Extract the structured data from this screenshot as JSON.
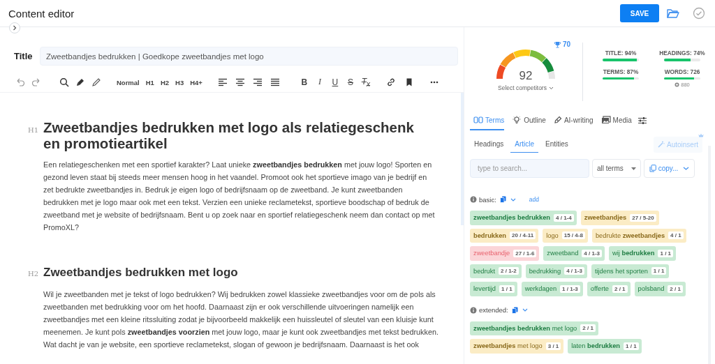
{
  "header": {
    "title": "Content editor",
    "save": "SAVE"
  },
  "title_field": {
    "label": "Title",
    "value": "Zweetbandjes bedrukken | Goedkope zweetbandjes met logo"
  },
  "toolbar": {
    "styles": [
      {
        "label": "Normal",
        "selected": false
      },
      {
        "label": "H1",
        "selected": false
      },
      {
        "label": "H2",
        "selected": false
      },
      {
        "label": "H3",
        "selected": false
      },
      {
        "label": "H4+",
        "selected": false
      }
    ],
    "formats": [
      "B",
      "I",
      "U",
      "S",
      "T$_{x}$"
    ]
  },
  "document": [
    {
      "kind": "heading",
      "tag": "H1",
      "text": "Zweetbandjes bedrukken met logo als relatiegeschenk en promotieartikel"
    },
    {
      "kind": "paragraph",
      "text": "Een relatiegeschenken met een sportief karakter? Laat unieke **zweetbandjes bedrukken** met jouw logo! Sporten en gezond leven staat bij steeds meer mensen hoog in het vaandel. Promoot ook het sportieve imago van je bedrijf en zet bedrukte zweetbandjes in. Bedruk je eigen logo of bedrijfsnaam op de zweetband. Je kunt zweetbanden bedrukken met je logo maar ook met een tekst. Verzien een unieke reclametekst, sportieve boodschap of bedruk de zweetband met je website of bedrijfsnaam. Bent u op zoek naar en sportief relatiegeschenk neem dan contact op met PromoXL?"
    },
    {
      "kind": "heading",
      "tag": "H2",
      "text": "Zweetbandjes bedrukken met logo"
    },
    {
      "kind": "paragraph",
      "text": "Wil je zweetbanden met je tekst of logo bedrukken? Wij bedrukken zowel klassieke zweetbandjes voor om de pols als zweetbanden met bedrukking voor om het hoofd. Daarnaast zijn er ook verschillende uitvoeringen namelijk een zweetbandjes met een kleine ritssluiting zodat je bijvoorbeeld makkelijk een huissleutel of sleutel van een kluisje kunt meenemen. Je kunt pols **zweetbandjes voorzien** met jouw logo, maar je kunt ook zweetbandjes met tekst bedrukken. Wat dacht je van je website, een sportieve reclametekst, slogan of gewoon je bedrijfsnaam. Daarnaast is het ook"
    }
  ],
  "score": {
    "value": "92",
    "target": "70",
    "competitors": "Select competitors"
  },
  "metrics": [
    {
      "label": "TITLE: 94%",
      "level": 0.94
    },
    {
      "label": "HEADINGS: 74%",
      "level": 0.74
    },
    {
      "label": "TERMS: 87%",
      "level": 0.87
    },
    {
      "label": "WORDS: 726",
      "level": 0.83,
      "note": "880"
    }
  ],
  "tabs": [
    {
      "label": "Terms",
      "selected": true
    },
    {
      "label": "Outline",
      "selected": false
    },
    {
      "label": "AI-writing",
      "selected": false
    },
    {
      "label": "Media",
      "selected": false
    }
  ],
  "subtabs": [
    {
      "label": "Headings",
      "selected": false
    },
    {
      "label": "Article",
      "selected": true
    },
    {
      "label": "Entities",
      "selected": false
    }
  ],
  "autoinsert": {
    "label": "Autoinsert",
    "disabled": true
  },
  "search": {
    "placeholder": "type to search..."
  },
  "filter": {
    "value": "all terms"
  },
  "copy": {
    "label": "copy..."
  },
  "term_groups": [
    {
      "label": "basic:",
      "add": "add",
      "terms": [
        {
          "text": "zweetbandjes bedrukken",
          "bold": true,
          "count": "4 / 1-4",
          "color": "#c8ead3"
        },
        {
          "text": "zweetbandjes",
          "bold": true,
          "count": "27 / 5-20",
          "color": "#fbecc5"
        },
        {
          "text": "bedrukken",
          "bold": true,
          "count": "20 / 4-11",
          "color": "#fbecc5"
        },
        {
          "text": "logo",
          "bold": false,
          "count": "15 / 4-8",
          "color": "#fbecc5"
        },
        {
          "text": "bedrukte **zweetbandjes**",
          "bold": false,
          "count": "4 / 1",
          "color": "#fbecc5"
        },
        {
          "text": "zweetbandje",
          "bold": false,
          "count": "27 / 1-6",
          "color": "#fbd5d8"
        },
        {
          "text": "zweetband",
          "bold": false,
          "count": "4 / 1-3",
          "color": "#c8ead3"
        },
        {
          "text": "wij **bedrukken**",
          "bold": false,
          "count": "1 / 1",
          "color": "#c8ead3"
        },
        {
          "text": "bedrukt",
          "bold": false,
          "count": "2 / 1-2",
          "color": "#c8ead3"
        },
        {
          "text": "bedrukking",
          "bold": false,
          "count": "4 / 1-3",
          "color": "#c8ead3"
        },
        {
          "text": "tijdens het sporten",
          "bold": false,
          "count": "1 / 1",
          "color": "#c8ead3"
        },
        {
          "text": "levertijd",
          "bold": false,
          "count": "1 / 1",
          "color": "#c8ead3"
        },
        {
          "text": "werkdagen",
          "bold": false,
          "count": "1 / 1-3",
          "color": "#c8ead3"
        },
        {
          "text": "offerte",
          "bold": false,
          "count": "2 / 1",
          "color": "#c8ead3"
        },
        {
          "text": "polsband",
          "bold": false,
          "count": "2 / 1",
          "color": "#c8ead3"
        }
      ]
    },
    {
      "label": "extended:",
      "terms": [
        {
          "text": "**zweetbandjes bedrukken** met logo",
          "bold": false,
          "count": "2 / 1",
          "color": "#c8ead3"
        },
        {
          "text": "**zweetbandjes** met logo",
          "bold": false,
          "count": "3 / 1",
          "color": "#fbecc5"
        },
        {
          "text": "laten **bedrukken**",
          "bold": false,
          "count": "1 / 1",
          "color": "#c8ead3"
        }
      ]
    }
  ]
}
